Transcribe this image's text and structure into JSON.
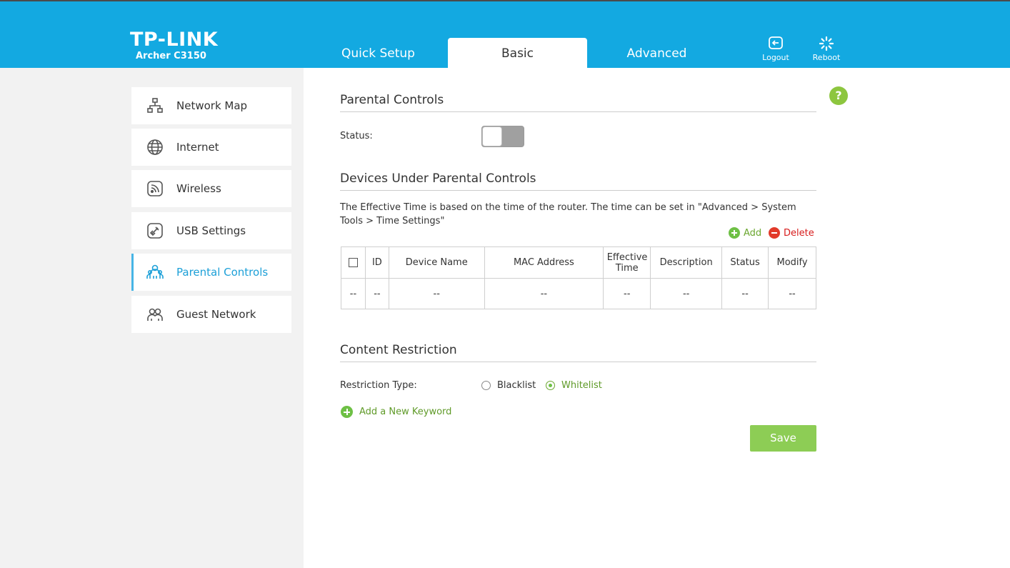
{
  "header": {
    "brand": "TP-LINK",
    "model": "Archer C3150",
    "tabs": [
      {
        "label": "Quick Setup"
      },
      {
        "label": "Basic"
      },
      {
        "label": "Advanced"
      }
    ],
    "active_tab": "Basic",
    "logout_label": "Logout",
    "reboot_label": "Reboot",
    "bg_color": "#13a9e1"
  },
  "sidebar": {
    "items": [
      {
        "label": "Network Map",
        "icon": "network-map-icon"
      },
      {
        "label": "Internet",
        "icon": "globe-icon"
      },
      {
        "label": "Wireless",
        "icon": "wireless-icon"
      },
      {
        "label": "USB Settings",
        "icon": "usb-icon"
      },
      {
        "label": "Parental Controls",
        "icon": "parental-controls-icon"
      },
      {
        "label": "Guest Network",
        "icon": "guest-network-icon"
      }
    ],
    "active_item": "Parental Controls"
  },
  "main": {
    "help_label": "?",
    "parental_controls": {
      "title": "Parental Controls",
      "status_label": "Status:",
      "status_on": false
    },
    "devices": {
      "title": "Devices Under Parental Controls",
      "description": "The Effective Time is based on the time of the router. The time can be set in \"Advanced > System Tools > Time Settings\"",
      "add_label": "Add",
      "delete_label": "Delete",
      "columns": [
        "ID",
        "Device Name",
        "MAC Address",
        "Effective Time",
        "Description",
        "Status",
        "Modify"
      ],
      "rows": [
        [
          "--",
          "--",
          "--",
          "--",
          "--",
          "--",
          "--",
          "--"
        ]
      ]
    },
    "content_restriction": {
      "title": "Content Restriction",
      "type_label": "Restriction Type:",
      "options": [
        "Blacklist",
        "Whitelist"
      ],
      "selected": "Whitelist",
      "add_keyword_label": "Add a New Keyword"
    },
    "save_label": "Save"
  }
}
